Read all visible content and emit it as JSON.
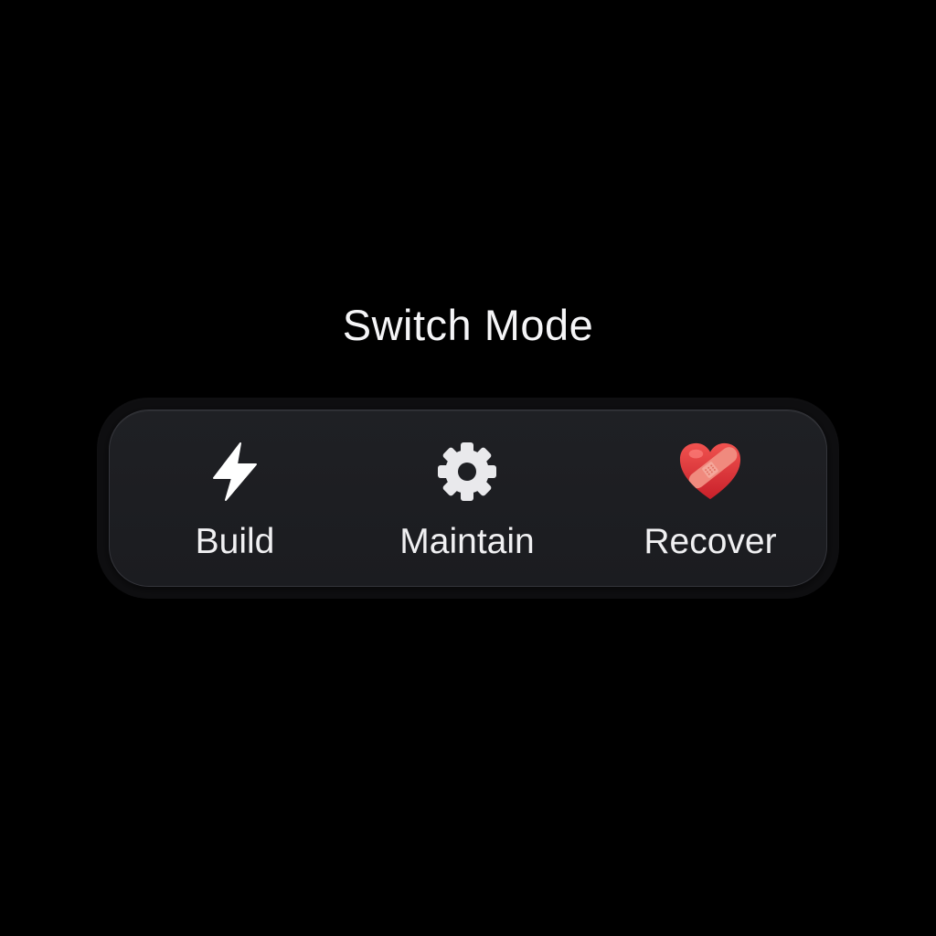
{
  "title": "Switch Mode",
  "modes": [
    {
      "label": "Build",
      "icon": "lightning-bolt-icon"
    },
    {
      "label": "Maintain",
      "icon": "gear-icon"
    },
    {
      "label": "Recover",
      "icon": "bandaged-heart-icon"
    }
  ],
  "colors": {
    "background": "#000000",
    "panel": "#1d1e22",
    "text": "#f2f2f4",
    "heart": "#e5383b",
    "bandage": "#f08a7e"
  }
}
